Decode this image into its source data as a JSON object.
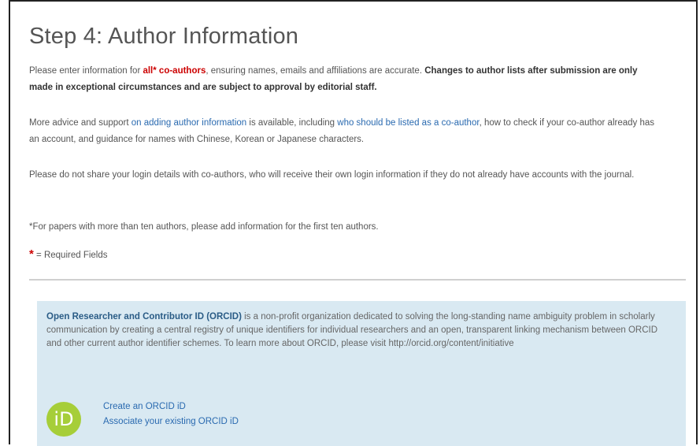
{
  "heading": "Step 4: Author Information",
  "intro": {
    "p1_a": "Please enter information for ",
    "p1_red": "all* co-authors",
    "p1_b": ", ensuring names, emails and affiliations are accurate. ",
    "p1_bold": "Changes to author lists after submission are only made in exceptional circumstances and are subject to approval by editorial staff."
  },
  "advice": {
    "a": "More advice and support ",
    "link1": "on adding author information",
    "b": " is available, including ",
    "link2": "who should be listed as a co-author",
    "c": ", how to check if your co-author already has an account, and guidance for names with Chinese, Korean or Japanese characters."
  },
  "login_note": "Please do not share your login details with co-authors, who will receive their own login information if they do not already have accounts with the journal.",
  "ten_authors_note": "*For papers with more than ten authors, please add information for the first ten authors.",
  "required": {
    "star": "*",
    "label": " = Required Fields"
  },
  "orcid": {
    "bold": "Open Researcher and Contributor ID (ORCID)",
    "text": " is a non-profit organization dedicated to solving the long-standing name ambiguity problem in scholarly communication by creating a central registry of unique identifiers for individual researchers and an open, transparent linking mechanism between ORCID and other current author identifier schemes. To learn more about ORCID, please visit http://orcid.org/content/initiative",
    "logo_text": "iD",
    "create_link": "Create an ORCID iD",
    "associate_link": "Associate your existing ORCID iD",
    "logo_color": "#a6ce39"
  },
  "colors": {
    "link": "#2a6ab0",
    "required": "#cc0000",
    "panel_bg": "#d9e9f2"
  }
}
